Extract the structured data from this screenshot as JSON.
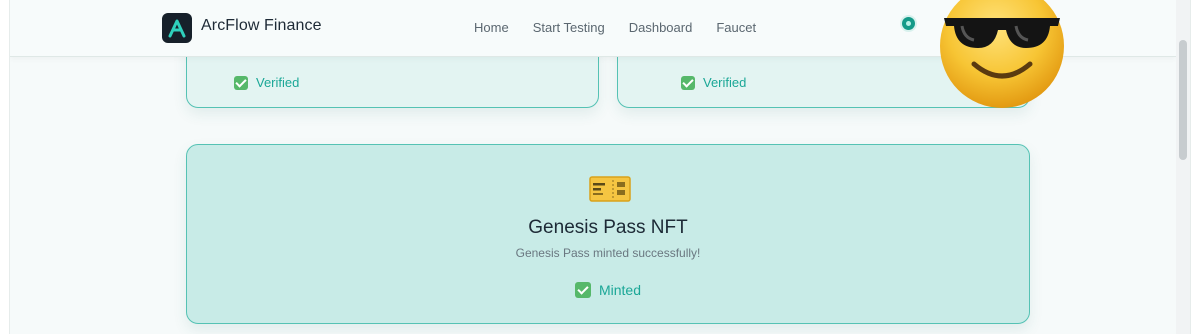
{
  "header": {
    "brand": "ArcFlow Finance",
    "nav": [
      "Home",
      "Start Testing",
      "Dashboard",
      "Faucet"
    ]
  },
  "cards": {
    "top_left_status": "Verified",
    "top_right_status": "Verified",
    "main": {
      "title": "Genesis Pass NFT",
      "description": "Genesis Pass minted successfully!",
      "status": "Minted"
    }
  },
  "icons": {
    "logo": "arcflow-logo-icon",
    "status": "network-status-icon",
    "sticker": "sunglasses-emoji-icon",
    "nft": "ticket-card-icon",
    "check": "check-mark-icon"
  },
  "colors": {
    "accent": "#1ba797",
    "card_border": "#55c2b4",
    "card_bg": "#e3f4f2",
    "main_card_bg": "#c8ebe7"
  }
}
